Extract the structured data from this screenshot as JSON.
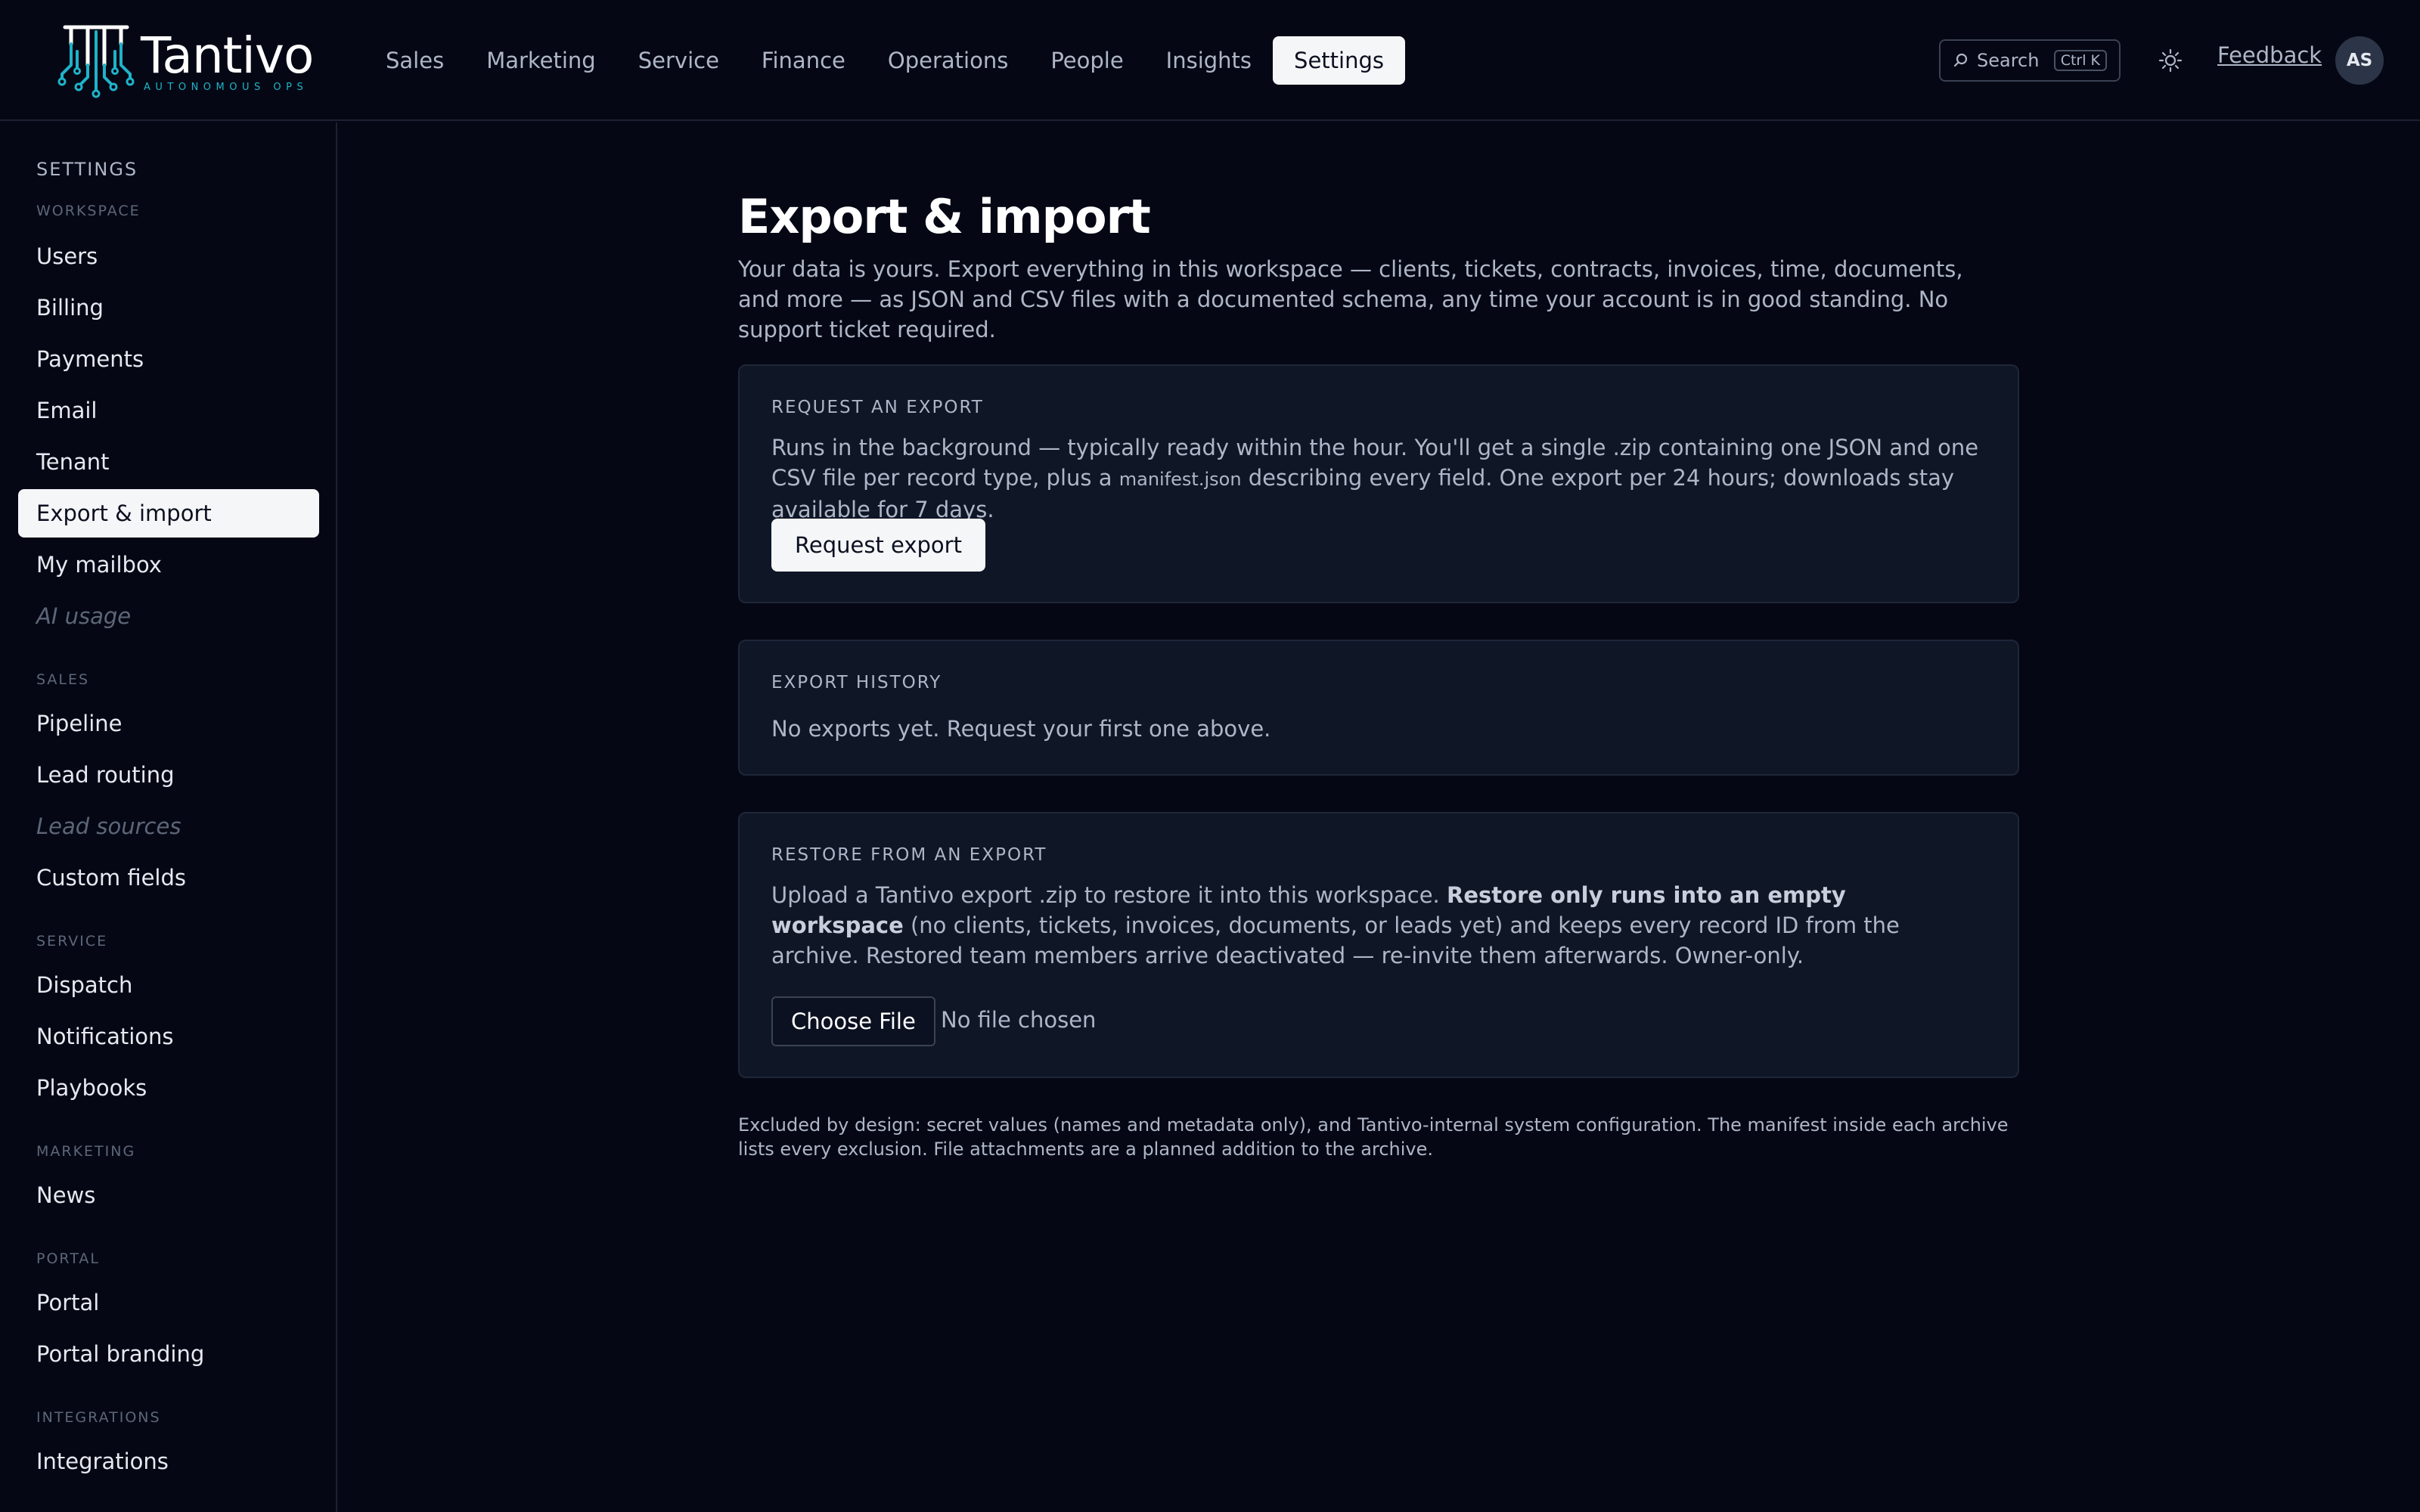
{
  "brand": {
    "name": "Tantivo",
    "tagline": "AUTONOMOUS OPS"
  },
  "nav": {
    "items": [
      {
        "label": "Sales"
      },
      {
        "label": "Marketing"
      },
      {
        "label": "Service"
      },
      {
        "label": "Finance"
      },
      {
        "label": "Operations"
      },
      {
        "label": "People"
      },
      {
        "label": "Insights"
      },
      {
        "label": "Settings",
        "active": true
      }
    ],
    "search_label": "Search",
    "search_shortcut": "Ctrl K",
    "feedback_label": "Feedback",
    "avatar_initials": "AS"
  },
  "sidebar": {
    "title": "SETTINGS",
    "sections": {
      "workspace": "WORKSPACE",
      "sales": "SALES",
      "service": "SERVICE",
      "marketing": "MARKETING",
      "portal": "PORTAL",
      "integrations": "INTEGRATIONS"
    },
    "items": {
      "users": "Users",
      "billing": "Billing",
      "payments": "Payments",
      "email": "Email",
      "tenant": "Tenant",
      "export_import": "Export & import",
      "my_mailbox": "My mailbox",
      "ai_usage": "AI usage",
      "pipeline": "Pipeline",
      "lead_routing": "Lead routing",
      "lead_sources": "Lead sources",
      "custom_fields": "Custom fields",
      "dispatch": "Dispatch",
      "notifications": "Notifications",
      "playbooks": "Playbooks",
      "news": "News",
      "portal": "Portal",
      "portal_branding": "Portal branding",
      "integrations": "Integrations"
    }
  },
  "main": {
    "title": "Export & import",
    "description": "Your data is yours. Export everything in this workspace — clients, tickets, contracts, invoices, time, documents, and more — as JSON and CSV files with a documented schema, any time your account is in good standing. No support ticket required.",
    "request_export": {
      "heading": "REQUEST AN EXPORT",
      "body_before": "Runs in the background — typically ready within the hour. You'll get a single .zip containing one JSON and one CSV file per record type, plus a ",
      "body_code": "manifest.json",
      "body_after": " describing every field. One export per 24 hours; downloads stay available for 7 days.",
      "button_label": "Request export"
    },
    "export_history": {
      "heading": "EXPORT HISTORY",
      "empty_text": "No exports yet. Request your first one above."
    },
    "restore": {
      "heading": "RESTORE FROM AN EXPORT",
      "body_before": "Upload a Tantivo export .zip to restore it into this workspace. ",
      "body_bold": "Restore only runs into an empty workspace",
      "body_after": " (no clients, tickets, invoices, documents, or leads yet) and keeps every record ID from the archive. Restored team members arrive deactivated — re-invite them afterwards. Owner-only.",
      "file_button_label": "Choose File",
      "file_status": "No file chosen"
    },
    "footnote": "Excluded by design: secret values (names and metadata only), and Tantivo-internal system configuration. The manifest inside each archive lists every exclusion. File attachments are a planned addition to the archive."
  },
  "colors": {
    "background": "#050814",
    "card": "#0f1626",
    "accent_logo": "#1fb3c9",
    "active_pill": "#f5f6f8"
  }
}
